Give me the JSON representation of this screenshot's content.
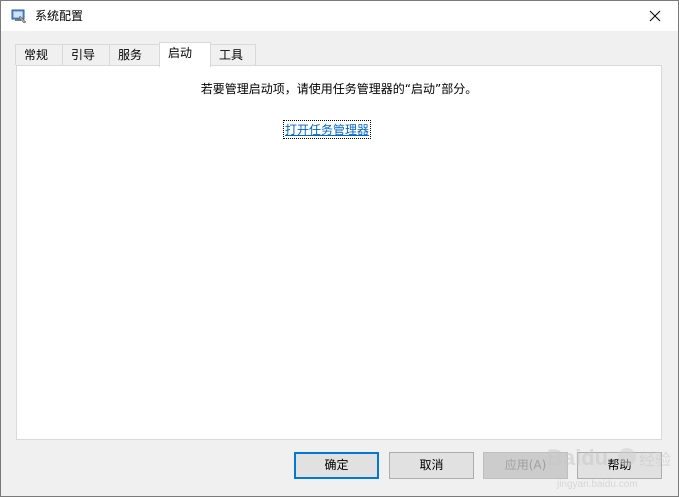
{
  "window": {
    "title": "系统配置"
  },
  "tabs": [
    {
      "label": "常规"
    },
    {
      "label": "引导"
    },
    {
      "label": "服务"
    },
    {
      "label": "启动"
    },
    {
      "label": "工具"
    }
  ],
  "panel": {
    "message": "若要管理启动项，请使用任务管理器的“启动”部分。",
    "link_label": "打开任务管理器"
  },
  "buttons": {
    "ok": "确定",
    "cancel": "取消",
    "apply": "应用(A)",
    "help": "帮助"
  },
  "watermark": {
    "brand": "Baidu",
    "cn": "经验",
    "url": "jingyan.baidu.com"
  },
  "colors": {
    "accent": "#0078d7",
    "link": "#0066cc"
  }
}
